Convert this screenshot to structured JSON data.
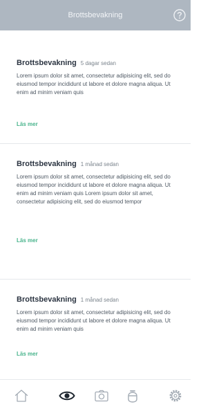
{
  "header": {
    "title": "Brottsbevakning"
  },
  "feed": {
    "items": [
      {
        "title": "Brottsbevakning",
        "time": "5 dagar sedan",
        "text": "Lorem ipsum dolor sit amet, consectetur adipisicing elit, sed do eiusmod tempor incididunt ut labore et dolore magna aliqua. Ut enim ad minim veniam quis",
        "link": "Läs mer"
      },
      {
        "title": "Brottsbevakning",
        "time": "1 månad sedan",
        "text": "Lorem ipsum dolor sit amet, consectetur adipisicing elit, sed do eiusmod tempor incididunt ut labore et dolore magna aliqua. Ut enim ad minim veniam quis Lorem ipsum dolor sit amet, consectetur adipisicing elit, sed do eiusmod tempor",
        "link": "Läs mer"
      },
      {
        "title": "Brottsbevakning",
        "time": "1 månad sedan",
        "text": "Lorem ipsum dolor sit amet, consectetur adipisicing elit, sed do eiusmod tempor incididunt ut labore et dolore magna aliqua. Ut enim ad minim veniam quis",
        "link": "Läs mer"
      }
    ]
  },
  "tabbar": {
    "tabs": [
      {
        "icon": "home-icon",
        "active": false
      },
      {
        "icon": "eye-icon",
        "active": true
      },
      {
        "icon": "camera-icon",
        "active": false
      },
      {
        "icon": "helmet-icon",
        "active": false
      },
      {
        "icon": "gear-icon",
        "active": false
      }
    ]
  },
  "colors": {
    "header_bg": "#aeb7c1",
    "accent": "#47b38b",
    "active_icon": "#1f2730",
    "inactive_icon": "#a3abb4"
  }
}
